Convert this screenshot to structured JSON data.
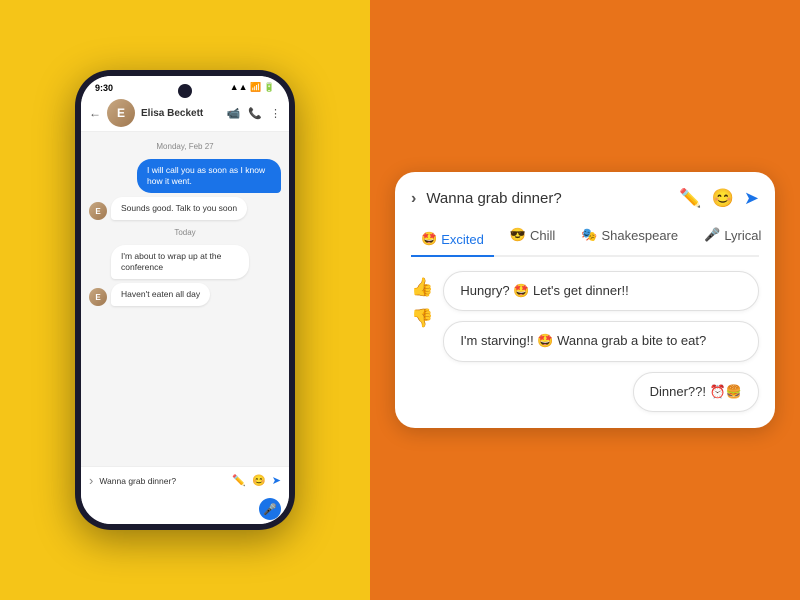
{
  "left": {
    "status_time": "9:30",
    "contact_name": "Elisa Beckett",
    "date_label_1": "Monday, Feb 27",
    "date_label_2": "Today",
    "messages": [
      {
        "type": "sent",
        "text": "I will call you as soon as I know how it went."
      },
      {
        "type": "received",
        "text": "Sounds good. Talk to you soon"
      },
      {
        "type": "received_no_avatar",
        "text": "I'm about to wrap up at the conference"
      },
      {
        "type": "received_no_avatar",
        "text": "Haven't eaten all day"
      }
    ],
    "input_text": "Wanna grab dinner?"
  },
  "right": {
    "input_text": "Wanna grab dinner?",
    "tabs": [
      {
        "label": "Excited",
        "emoji": "🤩",
        "active": true
      },
      {
        "label": "Chill",
        "emoji": "😎",
        "active": false
      },
      {
        "label": "Shakespeare",
        "emoji": "🎭",
        "active": false
      },
      {
        "label": "Lyrical",
        "emoji": "🎤",
        "active": false
      }
    ],
    "suggestions": [
      {
        "text": "Hungry? 🤩 Let's get dinner!!"
      },
      {
        "text": "I'm starving!! 🤩 Wanna grab a bite to eat?"
      },
      {
        "text": "Dinner??! ⏰🍔"
      }
    ],
    "thumbs_up": "👍",
    "thumbs_down": "👎",
    "send_icon": "➤",
    "edit_icon": "✏️",
    "emoji_icon": "😊"
  }
}
